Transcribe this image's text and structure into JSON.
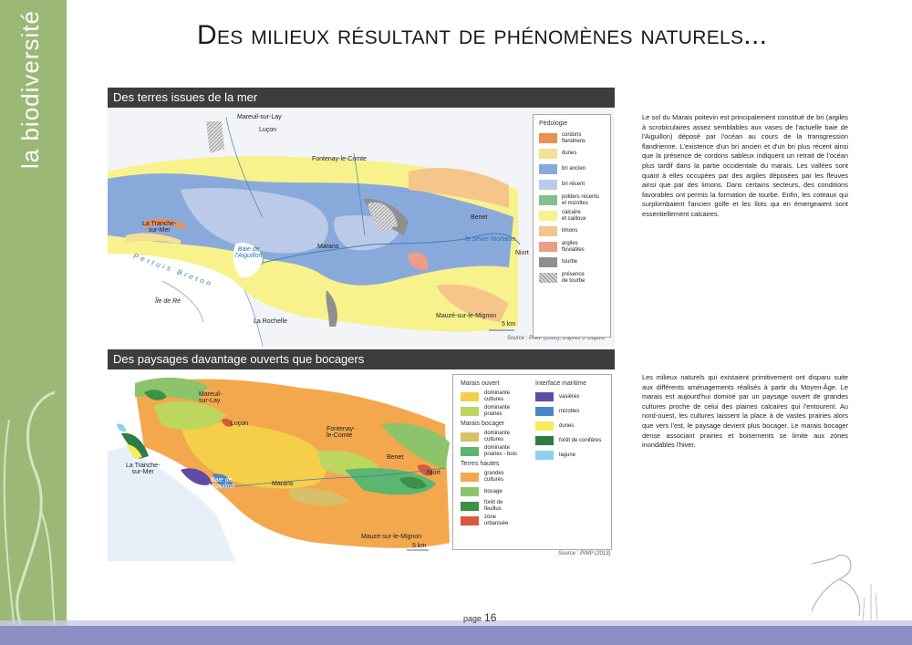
{
  "sidebar": {
    "title": "la biodiversité"
  },
  "page": {
    "title": "Des milieux résultant de phénomènes naturels...",
    "page_label": "page",
    "page_number": "16"
  },
  "section1": {
    "heading": "Des terres issues de la mer",
    "source": "Source : PIMP (2006), d'après J. Dupuis",
    "scale": "5 km",
    "places": {
      "mareuil": "Mareuil-sur-Lay",
      "lucon": "Luçon",
      "fontenay": "Fontenay-le-Comte",
      "tranche": "La Tranche-\nsur-Mer",
      "baie": "Baie de\nl'Aiguillon",
      "marans": "Marans",
      "benet": "Benet",
      "niort": "Niort",
      "sevre": "la Sèvre Niortaise",
      "pertuis": "Pertuis Breton",
      "re": "Île de Ré",
      "rochelle": "La Rochelle",
      "mauze": "Mauzé-sur-le-Mignon"
    },
    "legend": {
      "title": "Pédologie",
      "items": [
        {
          "label": "cordons\nflandriens",
          "color": "#ec8f55"
        },
        {
          "label": "dunes",
          "color": "#f6de94"
        },
        {
          "label": "bri ancien",
          "color": "#8aa9db"
        },
        {
          "label": "bri récent",
          "color": "#bccae9"
        },
        {
          "label": "polders récents\net mizottes",
          "color": "#82c08f"
        },
        {
          "label": "calcaire\net cailloux",
          "color": "#f7f28c"
        },
        {
          "label": "limons",
          "color": "#f6c589"
        },
        {
          "label": "argiles\nfluviatiles",
          "color": "#ef9c86"
        },
        {
          "label": "tourbe",
          "color": "#8f8f8f"
        },
        {
          "label": "présence\nde tourbe",
          "color": "#d8d8d8"
        }
      ]
    },
    "text": "Le sol du Marais poitevin est principalement constitué de bri (argiles à scrobiculaires assez semblables aux vases de l'actuelle baie de l'Aiguillon) déposé par l'océan au cours de la transgression flandrienne. L'existence d'un bri ancien et d'un bri plus récent ainsi que la présence de cordons sableux indiquent un retrait de l'océan plus tardif dans la partie occidentale du marais. Les vallées sont quant à elles occupées par des argiles déposées par les fleuves ainsi que par des limons. Dans certains secteurs, des conditions favorables ont permis la formation de tourbe. Enfin, les coteaux qui surplombaient l'ancien golfe et les îlots qui en émergeaient sont essentiellement calcaires."
  },
  "section2": {
    "heading": "Des paysages davantage ouverts que bocagers",
    "source": "Source : PIMP (2013)",
    "scale": "5 km",
    "places": {
      "mareuil": "Mareuil-\nsur-Lay",
      "lucon": "Luçon",
      "fontenay": "Fontenay-\nle-Comte",
      "tranche": "La Tranche-\nsur-Mer",
      "baie": "Baie de\nl'Aiguillon",
      "marans": "Marans",
      "benet": "Benet",
      "niort": "Niort",
      "mauze": "Mauzé-sur-le-Mignon"
    },
    "legend": {
      "groups_left": [
        {
          "title": "Marais ouvert",
          "items": [
            {
              "label": "dominante\ncultures",
              "color": "#f5cf4a"
            },
            {
              "label": "dominante\nprairies",
              "color": "#bcd65e"
            }
          ]
        },
        {
          "title": "Marais bocager",
          "items": [
            {
              "label": "dominante\ncultures",
              "color": "#d7c06a"
            },
            {
              "label": "dominante\nprairies - bois",
              "color": "#5bb66f"
            }
          ]
        },
        {
          "title": "Terres hautes",
          "items": [
            {
              "label": "grandes\ncultures",
              "color": "#f3a84e"
            },
            {
              "label": "bocage",
              "color": "#8cc36b"
            },
            {
              "label": "forêt de\nfeuillus",
              "color": "#3e8f47"
            },
            {
              "label": "zone\nurbanisée",
              "color": "#d9583f"
            }
          ]
        }
      ],
      "groups_right": [
        {
          "title": "Interface maritime",
          "items": [
            {
              "label": "vasières",
              "color": "#5f4aa8"
            },
            {
              "label": "mizottes",
              "color": "#4b86c8"
            },
            {
              "label": "dunes",
              "color": "#f6ec58"
            },
            {
              "label": "forêt de conifères",
              "color": "#2f7a45"
            },
            {
              "label": "lagune",
              "color": "#8fd0ef"
            }
          ]
        }
      ]
    },
    "text": "Les milieux naturels qui existaient primitivement ont disparu suite aux différents aménagements réalisés à partir du Moyen-Âge. Le marais est aujourd'hui dominé par un paysage ouvert de grandes cultures proche de celui des plaines calcaires qui l'entourent. Au nord-ouest, les cultures laissent la place à de vastes prairies alors que vers l'est, le paysage devient plus bocager. Le marais bocager dense associant prairies et boisements se limite aux zones inondables l'hiver."
  }
}
